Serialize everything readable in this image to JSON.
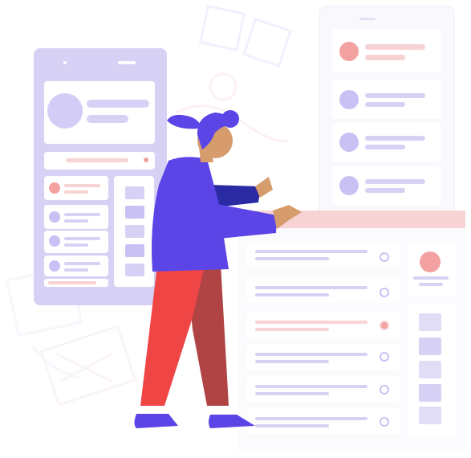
{
  "illustration": {
    "subject": "",
    "colors": {
      "purple": "#5b45e6",
      "lavender": "#d7d2f5",
      "lavender_dark": "#c9c1f3",
      "pink": "#f3a1a1",
      "pink_light": "#f7d3d3",
      "red_pants": "#f04545",
      "dark_red_pants": "#b04444",
      "skin": "#d79c6c",
      "navy": "#2a2aa3"
    }
  }
}
